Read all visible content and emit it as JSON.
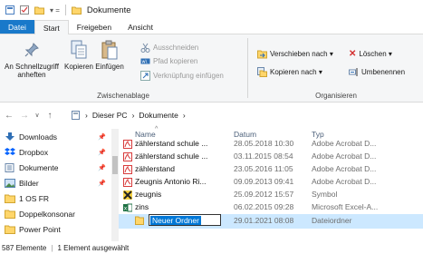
{
  "window": {
    "title": "Dokumente"
  },
  "ribbon_tabs": [
    "Datei",
    "Start",
    "Freigeben",
    "Ansicht"
  ],
  "clipboard_group": {
    "label": "Zwischenablage",
    "pin_label": "An Schnellzugriff anheften",
    "copy_label": "Kopieren",
    "paste_label": "Einfügen",
    "cut_label": "Ausschneiden",
    "copy_path_label": "Pfad kopieren",
    "paste_shortcut_label": "Verknüpfung einfügen"
  },
  "organize_group": {
    "label": "Organisieren",
    "move_to_label": "Verschieben nach ▾",
    "copy_to_label": "Kopieren nach ▾",
    "delete_label": "Löschen ▾",
    "rename_label": "Umbenennen"
  },
  "address": {
    "crumbs": [
      "Dieser PC",
      "Dokumente"
    ]
  },
  "navigation": {
    "items": [
      {
        "label": "Downloads",
        "pinned": true,
        "icon": "download-icon"
      },
      {
        "label": "Dropbox",
        "pinned": true,
        "icon": "dropbox-icon"
      },
      {
        "label": "Dokumente",
        "pinned": true,
        "icon": "documents-icon"
      },
      {
        "label": "Bilder",
        "pinned": true,
        "icon": "pictures-icon"
      },
      {
        "label": "1 OS FR",
        "pinned": false,
        "icon": "folder-icon"
      },
      {
        "label": "Doppelkonsonar",
        "pinned": false,
        "icon": "folder-icon"
      },
      {
        "label": "Power Point",
        "pinned": false,
        "icon": "folder-icon"
      }
    ]
  },
  "columns": {
    "name": "Name",
    "date": "Datum",
    "type": "Typ"
  },
  "files": [
    {
      "name": "zählerstand schule ...",
      "date": "28.05.2018 10:30",
      "type": "Adobe Acrobat D...",
      "icon": "pdf-icon"
    },
    {
      "name": "zählerstand schule ...",
      "date": "03.11.2015 08:54",
      "type": "Adobe Acrobat D...",
      "icon": "pdf-icon"
    },
    {
      "name": "zählerstand",
      "date": "23.05.2016 11:05",
      "type": "Adobe Acrobat D...",
      "icon": "pdf-icon"
    },
    {
      "name": "Zeugnis Antonio Ri...",
      "date": "09.09.2013 09:41",
      "type": "Adobe Acrobat D...",
      "icon": "pdf-icon"
    },
    {
      "name": "zeugnis",
      "date": "25.09.2012 15:57",
      "type": "Symbol",
      "icon": "symbol-icon"
    },
    {
      "name": "zins",
      "date": "06.02.2015 09:28",
      "type": "Microsoft Excel-A...",
      "icon": "excel-icon"
    }
  ],
  "new_folder": {
    "name": "Neuer Ordner",
    "date": "29.01.2021 08:08",
    "type": "Dateiordner"
  },
  "status": {
    "count": "587 Elemente",
    "selection": "1 Element ausgewählt"
  },
  "colors": {
    "accent": "#1979ca",
    "selection": "#cce8ff",
    "folder": "#ffd66b",
    "pdf": "#d83b3b",
    "excel": "#1f7244"
  }
}
